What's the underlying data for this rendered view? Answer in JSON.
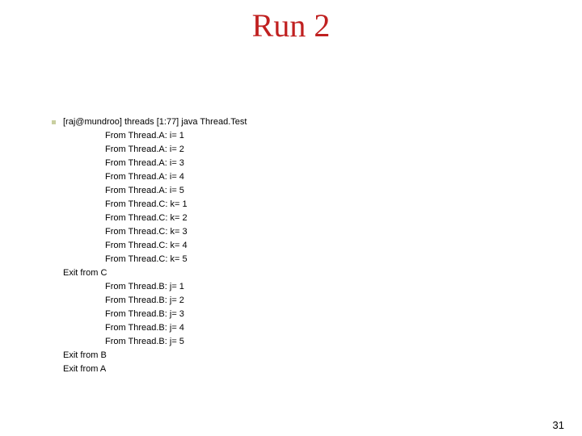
{
  "title": "Run 2",
  "command": "[raj@mundroo] threads [1:77] java Thread.Test",
  "lines": [
    {
      "indent": true,
      "text": "From Thread.A: i= 1"
    },
    {
      "indent": true,
      "text": "From Thread.A: i= 2"
    },
    {
      "indent": true,
      "text": "From Thread.A: i= 3"
    },
    {
      "indent": true,
      "text": "From Thread.A: i= 4"
    },
    {
      "indent": true,
      "text": "From Thread.A: i= 5"
    },
    {
      "indent": true,
      "text": "From Thread.C: k= 1"
    },
    {
      "indent": true,
      "text": "From Thread.C: k= 2"
    },
    {
      "indent": true,
      "text": "From Thread.C: k= 3"
    },
    {
      "indent": true,
      "text": "From Thread.C: k= 4"
    },
    {
      "indent": true,
      "text": "From Thread.C: k= 5"
    },
    {
      "indent": false,
      "text": "Exit from C"
    },
    {
      "indent": true,
      "text": "From Thread.B: j= 1"
    },
    {
      "indent": true,
      "text": "From Thread.B: j= 2"
    },
    {
      "indent": true,
      "text": "From Thread.B: j= 3"
    },
    {
      "indent": true,
      "text": "From Thread.B: j= 4"
    },
    {
      "indent": true,
      "text": "From Thread.B: j= 5"
    },
    {
      "indent": false,
      "text": "Exit from B"
    },
    {
      "indent": false,
      "text": "Exit from A"
    }
  ],
  "page_number": "31"
}
